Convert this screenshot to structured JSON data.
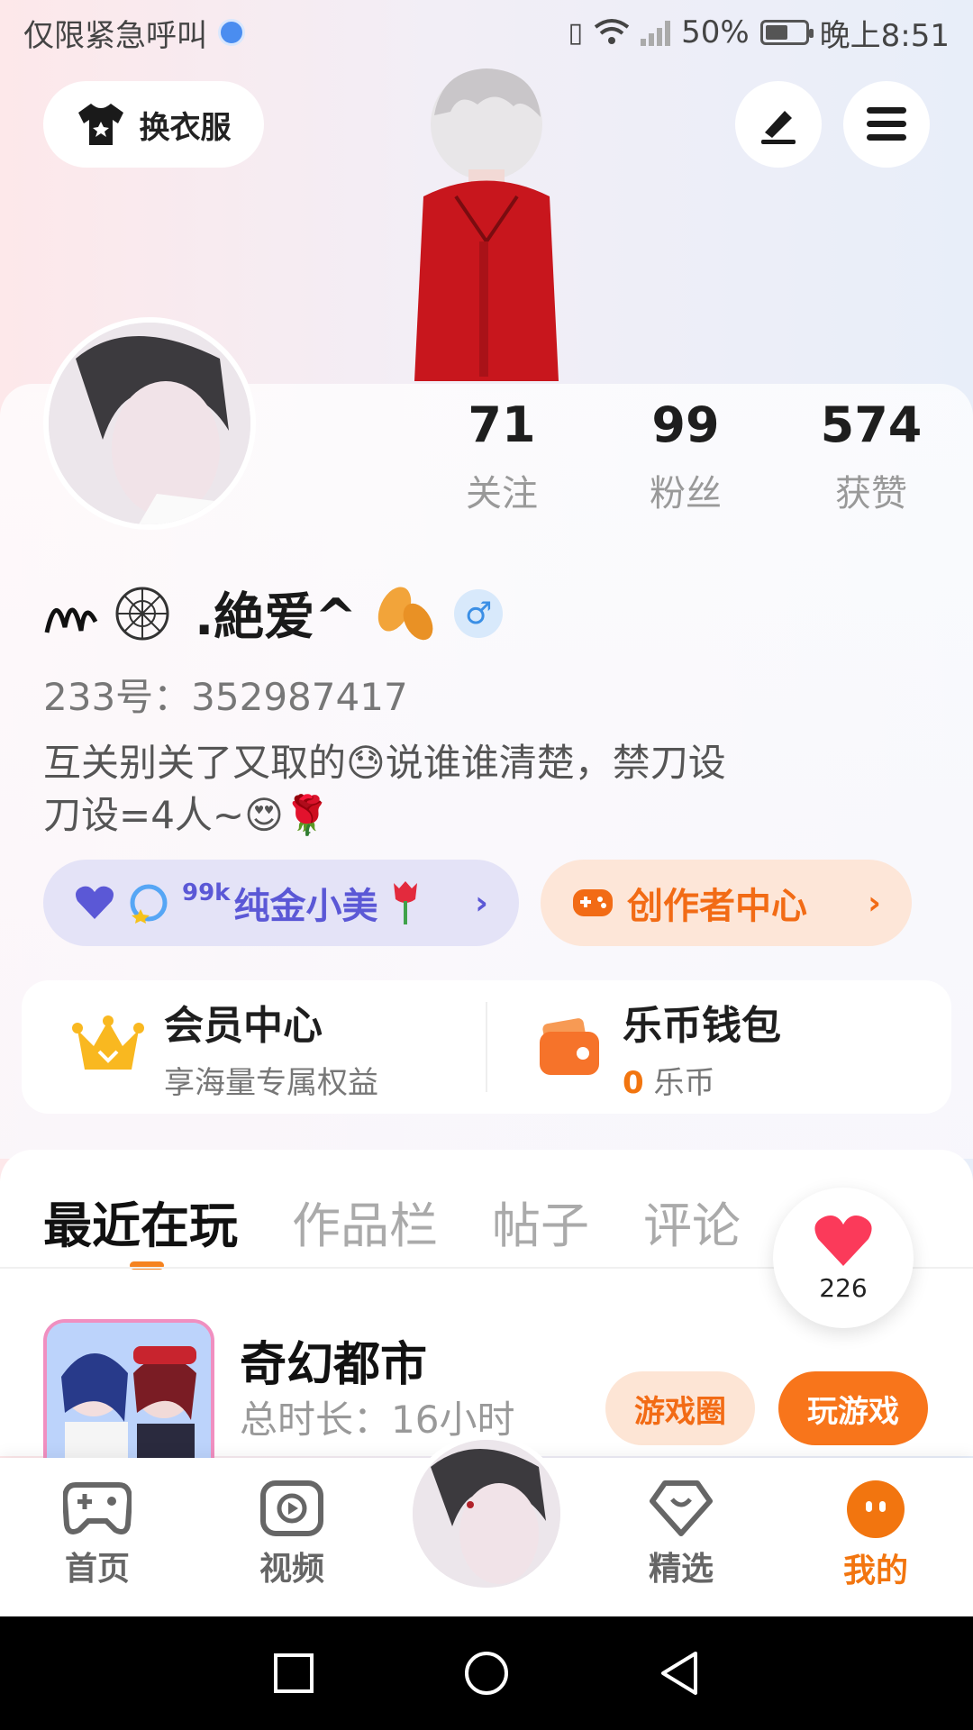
{
  "status_bar": {
    "carrier": "仅限紧急呼叫",
    "battery": "50%",
    "time": "晚上8:51"
  },
  "header": {
    "outfit_label": "换衣服",
    "edit_icon": "pen-icon",
    "menu_icon": "hamburger-menu-icon"
  },
  "profile": {
    "stats": [
      {
        "value": "71",
        "label": "关注"
      },
      {
        "value": "99",
        "label": "粉丝"
      },
      {
        "value": "574",
        "label": "获赞"
      }
    ],
    "name": ".絶爱^",
    "gender": "♂",
    "uid": "233号：352987417",
    "bio_line1": "互关别关了又取的😓说谁谁清楚，禁刀设",
    "bio_line2": "刀设=4人~😍🌹"
  },
  "pills": {
    "left_label": "纯金小美",
    "left_prefix": "99k",
    "right_label": "创作者中心"
  },
  "cards": {
    "vip_title": "会员中心",
    "vip_sub": "享海量专属权益",
    "wallet_title": "乐币钱包",
    "wallet_amount": "0",
    "wallet_unit": "乐币"
  },
  "tabs": [
    "最近在玩",
    "作品栏",
    "帖子",
    "评论"
  ],
  "likes": "226",
  "game": {
    "title": "奇幻都市",
    "time": "总时长：16小时",
    "circle_btn": "游戏圈",
    "play_btn": "玩游戏"
  },
  "bottom_nav": {
    "home": "首页",
    "video": "视频",
    "featured": "精选",
    "mine": "我的"
  },
  "colors": {
    "accent": "#f2750f",
    "purple": "#5b58d6"
  }
}
